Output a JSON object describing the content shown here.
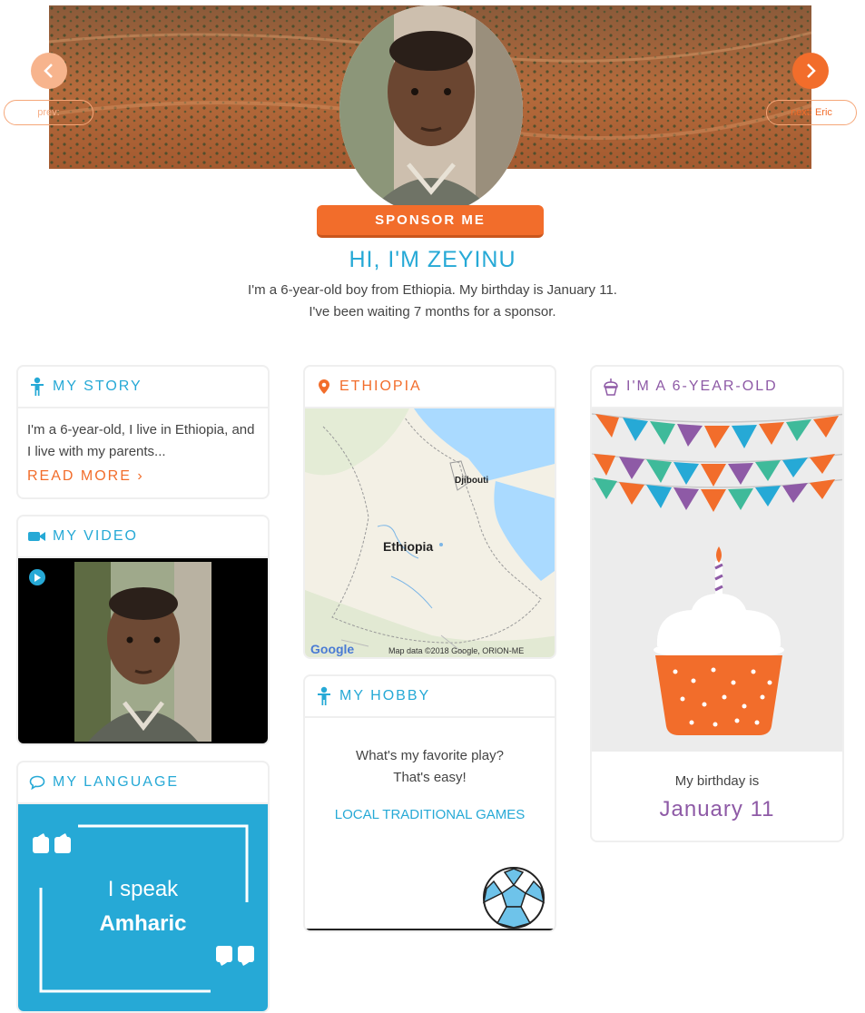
{
  "nav": {
    "prev_label": "prev:",
    "next_label": "next: Eric"
  },
  "sponsor_button": "SPONSOR ME",
  "greeting": "HI, I'M ZEYINU",
  "intro": {
    "line1": "I'm a 6-year-old boy from Ethiopia. My birthday is January 11.",
    "line2": "I've been waiting 7 months for a sponsor."
  },
  "story": {
    "title": "MY STORY",
    "text": "I'm a 6-year-old, I live in Ethiopia, and I live with my parents...",
    "read_more": "READ MORE ›"
  },
  "video": {
    "title": "MY VIDEO"
  },
  "language": {
    "title": "MY LANGUAGE",
    "line1": "I speak",
    "line2": "Amharic"
  },
  "country": {
    "title": "ETHIOPIA",
    "map_label_country": "Ethiopia",
    "map_label_city": "Djibouti",
    "map_attribution": "Map data ©2018 Google, ORION-ME",
    "map_brand": "Google"
  },
  "hobby": {
    "title": "MY HOBBY",
    "question1": "What's my favorite play?",
    "question2": "That's easy!",
    "name": "LOCAL TRADITIONAL GAMES"
  },
  "birthday": {
    "title": "I'M A 6-YEAR-OLD",
    "label": "My birthday is",
    "date": "January 11"
  },
  "colors": {
    "orange": "#f26d2b",
    "blue": "#26a9d6",
    "purple": "#8e5aa6"
  }
}
